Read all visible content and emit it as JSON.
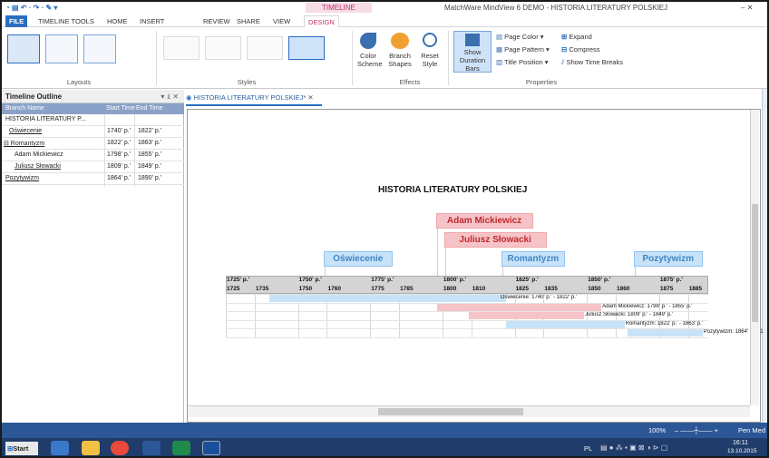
{
  "app": {
    "window_title": "MatchWare MindView 6 DEMO - HISTORIA LITERATURY POLSKIEJ",
    "context_tab_group": "TIMELINE",
    "window_controls": "– ✕"
  },
  "ribbon_tabs": [
    "FILE",
    "TIMELINE TOOLS",
    "HOME",
    "INSERT",
    "REVIEW",
    "SHARE",
    "VIEW",
    "DESIGN"
  ],
  "ribbon": {
    "groups": {
      "layouts": "Layouts",
      "styles": "Styles",
      "effects": "Effects",
      "properties": "Properties"
    },
    "buttons": {
      "color_scheme": "Color Scheme",
      "branch_shapes": "Branch Shapes",
      "reset_style": "Reset Style",
      "show_duration_bars": "Show Duration Bars",
      "page_color": "Page Color",
      "page_pattern": "Page Pattern",
      "title_position": "Title Position",
      "expand": "Expand",
      "compress": "Compress",
      "show_time_breaks": "Show Time Breaks"
    }
  },
  "outline": {
    "title": "Timeline Outline",
    "columns": [
      "Branch Name",
      "Start Time",
      "End Time"
    ],
    "rows": [
      {
        "name": "HISTORIA LITERATURY P...",
        "start": "",
        "end": ""
      },
      {
        "name": "Oświecenie",
        "start": "1740' p.'",
        "end": "1822' p.'"
      },
      {
        "name": "⊟ Romantyzm",
        "start": "1822' p.'",
        "end": "1863' p.'"
      },
      {
        "name": "Adam Mickiewicz",
        "start": "1798' p.'",
        "end": "1855' p.'"
      },
      {
        "name": "Juliusz Słowacki",
        "start": "1809' p.'",
        "end": "1849' p.'"
      },
      {
        "name": "Pozytywizm",
        "start": "1864' p.'",
        "end": "1890' p.'"
      }
    ]
  },
  "document_tab": "HISTORIA LITERATURY POLSKIEJ*",
  "timeline": {
    "title": "HISTORIA LITERATURY POLSKIEJ",
    "range": [
      1725,
      1892
    ],
    "major_ticks": [
      "1725' p.'",
      "1750' p.'",
      "1775' p.'",
      "1800' p.'",
      "1825' p.'",
      "1850' p.'",
      "1875' p.'"
    ],
    "minor_ticks": [
      "1725",
      "1735",
      "1750",
      "1760",
      "1775",
      "1785",
      "1800",
      "1810",
      "1825",
      "1835",
      "1850",
      "1860",
      "1875",
      "1885"
    ],
    "branches": [
      {
        "name": "Oświecenie",
        "start": 1740,
        "end": 1822,
        "label": "Oświecenie: 1740' p.' - 1822' p.'",
        "color": "#c8e3f8",
        "text_color": "#3d86c6"
      },
      {
        "name": "Adam Mickiewicz",
        "start": 1798,
        "end": 1855,
        "label": "Adam Mickiewicz: 1798' p.' - 1855' p.'",
        "color": "#f6c4c8",
        "text_color": "#c0282d"
      },
      {
        "name": "Juliusz Słowacki",
        "start": 1809,
        "end": 1849,
        "label": "Juliusz Słowacki: 1809' p.' - 1849' p.'",
        "color": "#f6c4c8",
        "text_color": "#c0282d"
      },
      {
        "name": "Romantyzm",
        "start": 1822,
        "end": 1863,
        "label": "Romantyzm: 1822' p.' - 1863' p.'",
        "color": "#c8e3f8",
        "text_color": "#3d86c6"
      },
      {
        "name": "Pozytywizm",
        "start": 1864,
        "end": 1890,
        "label": "Pozytywizm: 1864' p.' - 1",
        "color": "#c8e3f8",
        "text_color": "#3d86c6"
      }
    ]
  },
  "status_bar": {
    "zoom": "100%",
    "right": "Pen Med"
  },
  "taskbar": {
    "start": "Start",
    "lang": "PL",
    "time": "16:11",
    "date": "13.10.2015"
  }
}
